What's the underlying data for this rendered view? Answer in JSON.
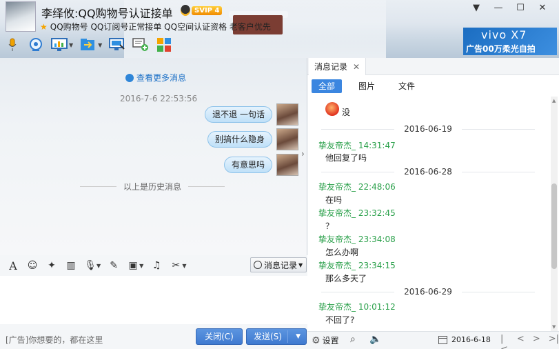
{
  "window": {
    "contact_name": "李绎攸:QQ购物号认证接单",
    "svip_badge": "SVIP 4",
    "signature": "QQ购物号 QQ订阅号正常接单 QQ空间认证资格 老客户优先",
    "controls": [
      "▼",
      "—",
      "☐",
      "✕"
    ]
  },
  "ad": {
    "brand": "vivo X7",
    "tagline": "广告00万柔光自拍"
  },
  "chat": {
    "more_messages": "查看更多消息",
    "timestamp": "2016-7-6 22:53:56",
    "messages": [
      "退不退  一句话",
      "别搞什么隐身",
      "有意思吗"
    ],
    "history_divider": "以上是历史消息"
  },
  "input_toolbar": {
    "history_button": "消息记录"
  },
  "bottom": {
    "ad_text": "[广告]你想要的，都在这里",
    "close_label": "关闭(C)",
    "send_label": "发送(S)"
  },
  "history_panel": {
    "tab_label": "消息记录",
    "filters": [
      "全部",
      "图片",
      "文件"
    ],
    "first_text": "没",
    "records": [
      {
        "type": "date",
        "text": "2016-06-19"
      },
      {
        "type": "msg",
        "sender": "挚友帝杰_ 14:31:47",
        "text": "他回复了吗"
      },
      {
        "type": "date",
        "text": "2016-06-28"
      },
      {
        "type": "msg",
        "sender": "挚友帝杰_ 22:48:06",
        "text": "在吗"
      },
      {
        "type": "msg",
        "sender": "挚友帝杰_ 23:32:45",
        "text": "？"
      },
      {
        "type": "msg",
        "sender": "挚友帝杰_ 23:34:08",
        "text": "怎么办啊"
      },
      {
        "type": "msg",
        "sender": "挚友帝杰_ 23:34:15",
        "text": "那么多天了"
      },
      {
        "type": "date",
        "text": "2016-06-29"
      },
      {
        "type": "msg",
        "sender": "挚友帝杰_ 10:01:12",
        "text": "不回了?"
      }
    ],
    "settings_label": "设置",
    "date_label": "2016-6-18"
  }
}
